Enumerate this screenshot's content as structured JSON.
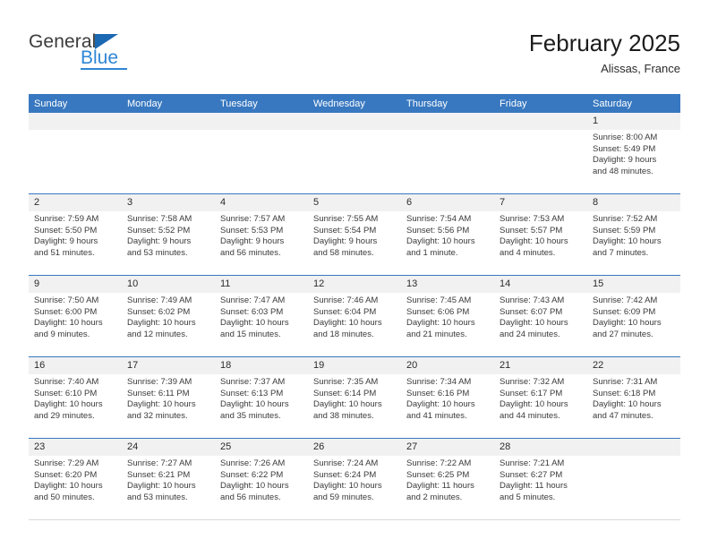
{
  "brand": {
    "name_part1": "General",
    "name_part2": "Blue",
    "triangle_color": "#1b68b3",
    "blue_color": "#2f86d4"
  },
  "header": {
    "title": "February 2025",
    "location": "Alissas, France",
    "header_bg": "#3878c0",
    "header_text_color": "#ffffff",
    "daynum_bg": "#f1f1f1"
  },
  "weekdays": [
    "Sunday",
    "Monday",
    "Tuesday",
    "Wednesday",
    "Thursday",
    "Friday",
    "Saturday"
  ],
  "weeks": [
    [
      {
        "day": "",
        "empty": true
      },
      {
        "day": "",
        "empty": true
      },
      {
        "day": "",
        "empty": true
      },
      {
        "day": "",
        "empty": true
      },
      {
        "day": "",
        "empty": true
      },
      {
        "day": "",
        "empty": true
      },
      {
        "day": "1",
        "sunrise": "Sunrise: 8:00 AM",
        "sunset": "Sunset: 5:49 PM",
        "daylight1": "Daylight: 9 hours",
        "daylight2": "and 48 minutes."
      }
    ],
    [
      {
        "day": "2",
        "sunrise": "Sunrise: 7:59 AM",
        "sunset": "Sunset: 5:50 PM",
        "daylight1": "Daylight: 9 hours",
        "daylight2": "and 51 minutes."
      },
      {
        "day": "3",
        "sunrise": "Sunrise: 7:58 AM",
        "sunset": "Sunset: 5:52 PM",
        "daylight1": "Daylight: 9 hours",
        "daylight2": "and 53 minutes."
      },
      {
        "day": "4",
        "sunrise": "Sunrise: 7:57 AM",
        "sunset": "Sunset: 5:53 PM",
        "daylight1": "Daylight: 9 hours",
        "daylight2": "and 56 minutes."
      },
      {
        "day": "5",
        "sunrise": "Sunrise: 7:55 AM",
        "sunset": "Sunset: 5:54 PM",
        "daylight1": "Daylight: 9 hours",
        "daylight2": "and 58 minutes."
      },
      {
        "day": "6",
        "sunrise": "Sunrise: 7:54 AM",
        "sunset": "Sunset: 5:56 PM",
        "daylight1": "Daylight: 10 hours",
        "daylight2": "and 1 minute."
      },
      {
        "day": "7",
        "sunrise": "Sunrise: 7:53 AM",
        "sunset": "Sunset: 5:57 PM",
        "daylight1": "Daylight: 10 hours",
        "daylight2": "and 4 minutes."
      },
      {
        "day": "8",
        "sunrise": "Sunrise: 7:52 AM",
        "sunset": "Sunset: 5:59 PM",
        "daylight1": "Daylight: 10 hours",
        "daylight2": "and 7 minutes."
      }
    ],
    [
      {
        "day": "9",
        "sunrise": "Sunrise: 7:50 AM",
        "sunset": "Sunset: 6:00 PM",
        "daylight1": "Daylight: 10 hours",
        "daylight2": "and 9 minutes."
      },
      {
        "day": "10",
        "sunrise": "Sunrise: 7:49 AM",
        "sunset": "Sunset: 6:02 PM",
        "daylight1": "Daylight: 10 hours",
        "daylight2": "and 12 minutes."
      },
      {
        "day": "11",
        "sunrise": "Sunrise: 7:47 AM",
        "sunset": "Sunset: 6:03 PM",
        "daylight1": "Daylight: 10 hours",
        "daylight2": "and 15 minutes."
      },
      {
        "day": "12",
        "sunrise": "Sunrise: 7:46 AM",
        "sunset": "Sunset: 6:04 PM",
        "daylight1": "Daylight: 10 hours",
        "daylight2": "and 18 minutes."
      },
      {
        "day": "13",
        "sunrise": "Sunrise: 7:45 AM",
        "sunset": "Sunset: 6:06 PM",
        "daylight1": "Daylight: 10 hours",
        "daylight2": "and 21 minutes."
      },
      {
        "day": "14",
        "sunrise": "Sunrise: 7:43 AM",
        "sunset": "Sunset: 6:07 PM",
        "daylight1": "Daylight: 10 hours",
        "daylight2": "and 24 minutes."
      },
      {
        "day": "15",
        "sunrise": "Sunrise: 7:42 AM",
        "sunset": "Sunset: 6:09 PM",
        "daylight1": "Daylight: 10 hours",
        "daylight2": "and 27 minutes."
      }
    ],
    [
      {
        "day": "16",
        "sunrise": "Sunrise: 7:40 AM",
        "sunset": "Sunset: 6:10 PM",
        "daylight1": "Daylight: 10 hours",
        "daylight2": "and 29 minutes."
      },
      {
        "day": "17",
        "sunrise": "Sunrise: 7:39 AM",
        "sunset": "Sunset: 6:11 PM",
        "daylight1": "Daylight: 10 hours",
        "daylight2": "and 32 minutes."
      },
      {
        "day": "18",
        "sunrise": "Sunrise: 7:37 AM",
        "sunset": "Sunset: 6:13 PM",
        "daylight1": "Daylight: 10 hours",
        "daylight2": "and 35 minutes."
      },
      {
        "day": "19",
        "sunrise": "Sunrise: 7:35 AM",
        "sunset": "Sunset: 6:14 PM",
        "daylight1": "Daylight: 10 hours",
        "daylight2": "and 38 minutes."
      },
      {
        "day": "20",
        "sunrise": "Sunrise: 7:34 AM",
        "sunset": "Sunset: 6:16 PM",
        "daylight1": "Daylight: 10 hours",
        "daylight2": "and 41 minutes."
      },
      {
        "day": "21",
        "sunrise": "Sunrise: 7:32 AM",
        "sunset": "Sunset: 6:17 PM",
        "daylight1": "Daylight: 10 hours",
        "daylight2": "and 44 minutes."
      },
      {
        "day": "22",
        "sunrise": "Sunrise: 7:31 AM",
        "sunset": "Sunset: 6:18 PM",
        "daylight1": "Daylight: 10 hours",
        "daylight2": "and 47 minutes."
      }
    ],
    [
      {
        "day": "23",
        "sunrise": "Sunrise: 7:29 AM",
        "sunset": "Sunset: 6:20 PM",
        "daylight1": "Daylight: 10 hours",
        "daylight2": "and 50 minutes."
      },
      {
        "day": "24",
        "sunrise": "Sunrise: 7:27 AM",
        "sunset": "Sunset: 6:21 PM",
        "daylight1": "Daylight: 10 hours",
        "daylight2": "and 53 minutes."
      },
      {
        "day": "25",
        "sunrise": "Sunrise: 7:26 AM",
        "sunset": "Sunset: 6:22 PM",
        "daylight1": "Daylight: 10 hours",
        "daylight2": "and 56 minutes."
      },
      {
        "day": "26",
        "sunrise": "Sunrise: 7:24 AM",
        "sunset": "Sunset: 6:24 PM",
        "daylight1": "Daylight: 10 hours",
        "daylight2": "and 59 minutes."
      },
      {
        "day": "27",
        "sunrise": "Sunrise: 7:22 AM",
        "sunset": "Sunset: 6:25 PM",
        "daylight1": "Daylight: 11 hours",
        "daylight2": "and 2 minutes."
      },
      {
        "day": "28",
        "sunrise": "Sunrise: 7:21 AM",
        "sunset": "Sunset: 6:27 PM",
        "daylight1": "Daylight: 11 hours",
        "daylight2": "and 5 minutes."
      },
      {
        "day": "",
        "empty": true
      }
    ]
  ]
}
